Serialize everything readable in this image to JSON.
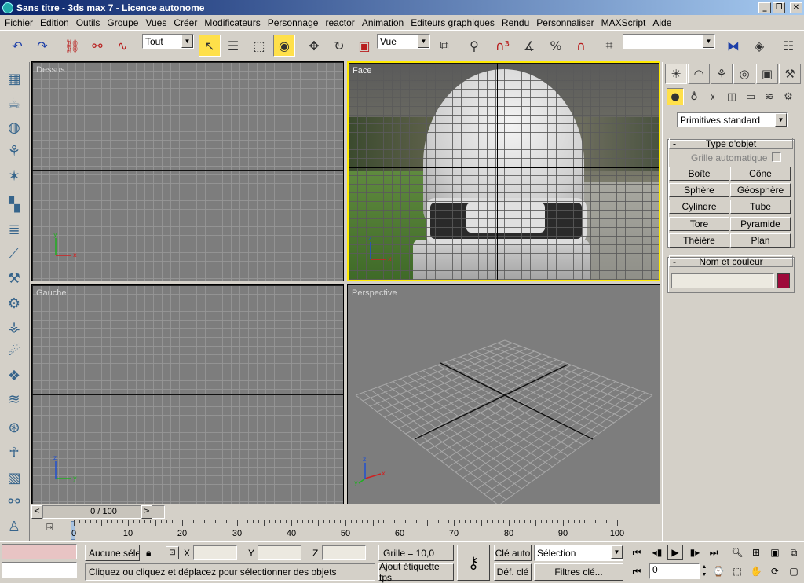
{
  "window": {
    "title": "Sans titre - 3ds max 7 - Licence autonome"
  },
  "menu": [
    "Fichier",
    "Edition",
    "Outils",
    "Groupe",
    "Vues",
    "Créer",
    "Modificateurs",
    "Personnage",
    "reactor",
    "Animation",
    "Editeurs graphiques",
    "Rendu",
    "Personnaliser",
    "MAXScript",
    "Aide"
  ],
  "toolbar": {
    "selection_filter": "Tout",
    "reference_coord": "Vue",
    "named_selection": ""
  },
  "viewports": {
    "top_left": "Dessus",
    "top_right": "Face",
    "bottom_left": "Gauche",
    "bottom_right": "Perspective"
  },
  "command_panel": {
    "category": "Primitives standard",
    "object_type": {
      "header": "Type d'objet",
      "autogrid": "Grille automatique",
      "buttons": [
        "Boîte",
        "Cône",
        "Sphère",
        "Géosphère",
        "Cylindre",
        "Tube",
        "Tore",
        "Pyramide",
        "Théière",
        "Plan"
      ]
    },
    "name_color": {
      "header": "Nom et couleur",
      "name_value": "",
      "color": "#9e0a3a"
    }
  },
  "time_slider": {
    "frame_display": "0 / 100",
    "prev": "<",
    "next": ">"
  },
  "trackbar": {
    "ticks": [
      "0",
      "10",
      "20",
      "30",
      "40",
      "50",
      "60",
      "70",
      "80",
      "90",
      "100"
    ]
  },
  "status": {
    "selection": "Aucune sélec",
    "prompt": "Cliquez ou cliquez et déplacez pour sélectionner des objets",
    "x_label": "X",
    "y_label": "Y",
    "z_label": "Z",
    "grid": "Grille = 10,0",
    "add_time_tag": "Ajout étiquette tps",
    "auto_key": "Clé auto",
    "set_key": "Déf. clé",
    "key_mode": "Sélection",
    "key_filters": "Filtres clé...",
    "current_frame": "0"
  }
}
